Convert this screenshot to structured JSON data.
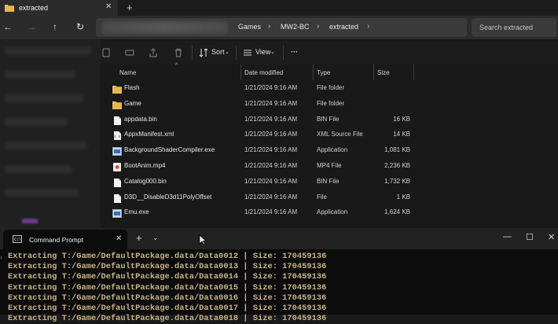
{
  "explorer": {
    "tab_label": "extracted",
    "breadcrumb": [
      "Games",
      "MW2-BC",
      "extracted"
    ],
    "search_placeholder": "Search extracted",
    "toolbar": {
      "sort_label": "Sort",
      "view_label": "View",
      "more_label": "···"
    },
    "columns": {
      "name": "Name",
      "date": "Date modified",
      "type": "Type",
      "size": "Size"
    },
    "files": [
      {
        "name": "Flash",
        "date": "1/21/2024 9:16 AM",
        "type": "File folder",
        "size": "",
        "icon": "folder-icon"
      },
      {
        "name": "Game",
        "date": "1/21/2024 9:16 AM",
        "type": "File folder",
        "size": "",
        "icon": "folder-icon"
      },
      {
        "name": "appdata.bin",
        "date": "1/21/2024 9:16 AM",
        "type": "BIN File",
        "size": "16 KB",
        "icon": "file-icon"
      },
      {
        "name": "AppxManifest.xml",
        "date": "1/21/2024 9:16 AM",
        "type": "XML Source File",
        "size": "14 KB",
        "icon": "xml-file-icon"
      },
      {
        "name": "BackgroundShaderCompiler.exe",
        "date": "1/21/2024 9:16 AM",
        "type": "Application",
        "size": "1,081 KB",
        "icon": "exe-icon"
      },
      {
        "name": "BootAnim.mp4",
        "date": "1/21/2024 9:16 AM",
        "type": "MP4 File",
        "size": "2,236 KB",
        "icon": "video-file-icon"
      },
      {
        "name": "Catalog000.bin",
        "date": "1/21/2024 9:16 AM",
        "type": "BIN File",
        "size": "1,732 KB",
        "icon": "file-icon"
      },
      {
        "name": "D3D__DisableD3d11PolyOffset",
        "date": "1/21/2024 9:16 AM",
        "type": "File",
        "size": "1 KB",
        "icon": "file-icon"
      },
      {
        "name": "Emu.exe",
        "date": "1/21/2024 9:16 AM",
        "type": "Application",
        "size": "1,624 KB",
        "icon": "exe-icon"
      }
    ]
  },
  "terminal": {
    "tab_label": "Command Prompt",
    "lines": [
      "Extracting T:/Game/DefaultPackage.data/Data0012 | Size: 170459136",
      "Extracting T:/Game/DefaultPackage.data/Data0013 | Size: 170459136",
      "Extracting T:/Game/DefaultPackage.data/Data0014 | Size: 170459136",
      "Extracting T:/Game/DefaultPackage.data/Data0015 | Size: 170459136",
      "Extracting T:/Game/DefaultPackage.data/Data0016 | Size: 170459136",
      "Extracting T:/Game/DefaultPackage.data/Data0017 | Size: 170459136",
      "Extracting T:/Game/DefaultPackage.data/Data0018 | Size: 170459136"
    ]
  },
  "colors": {
    "folder": "#e8b84a",
    "terminal_text": "#c7b48a",
    "background": "#191919"
  }
}
